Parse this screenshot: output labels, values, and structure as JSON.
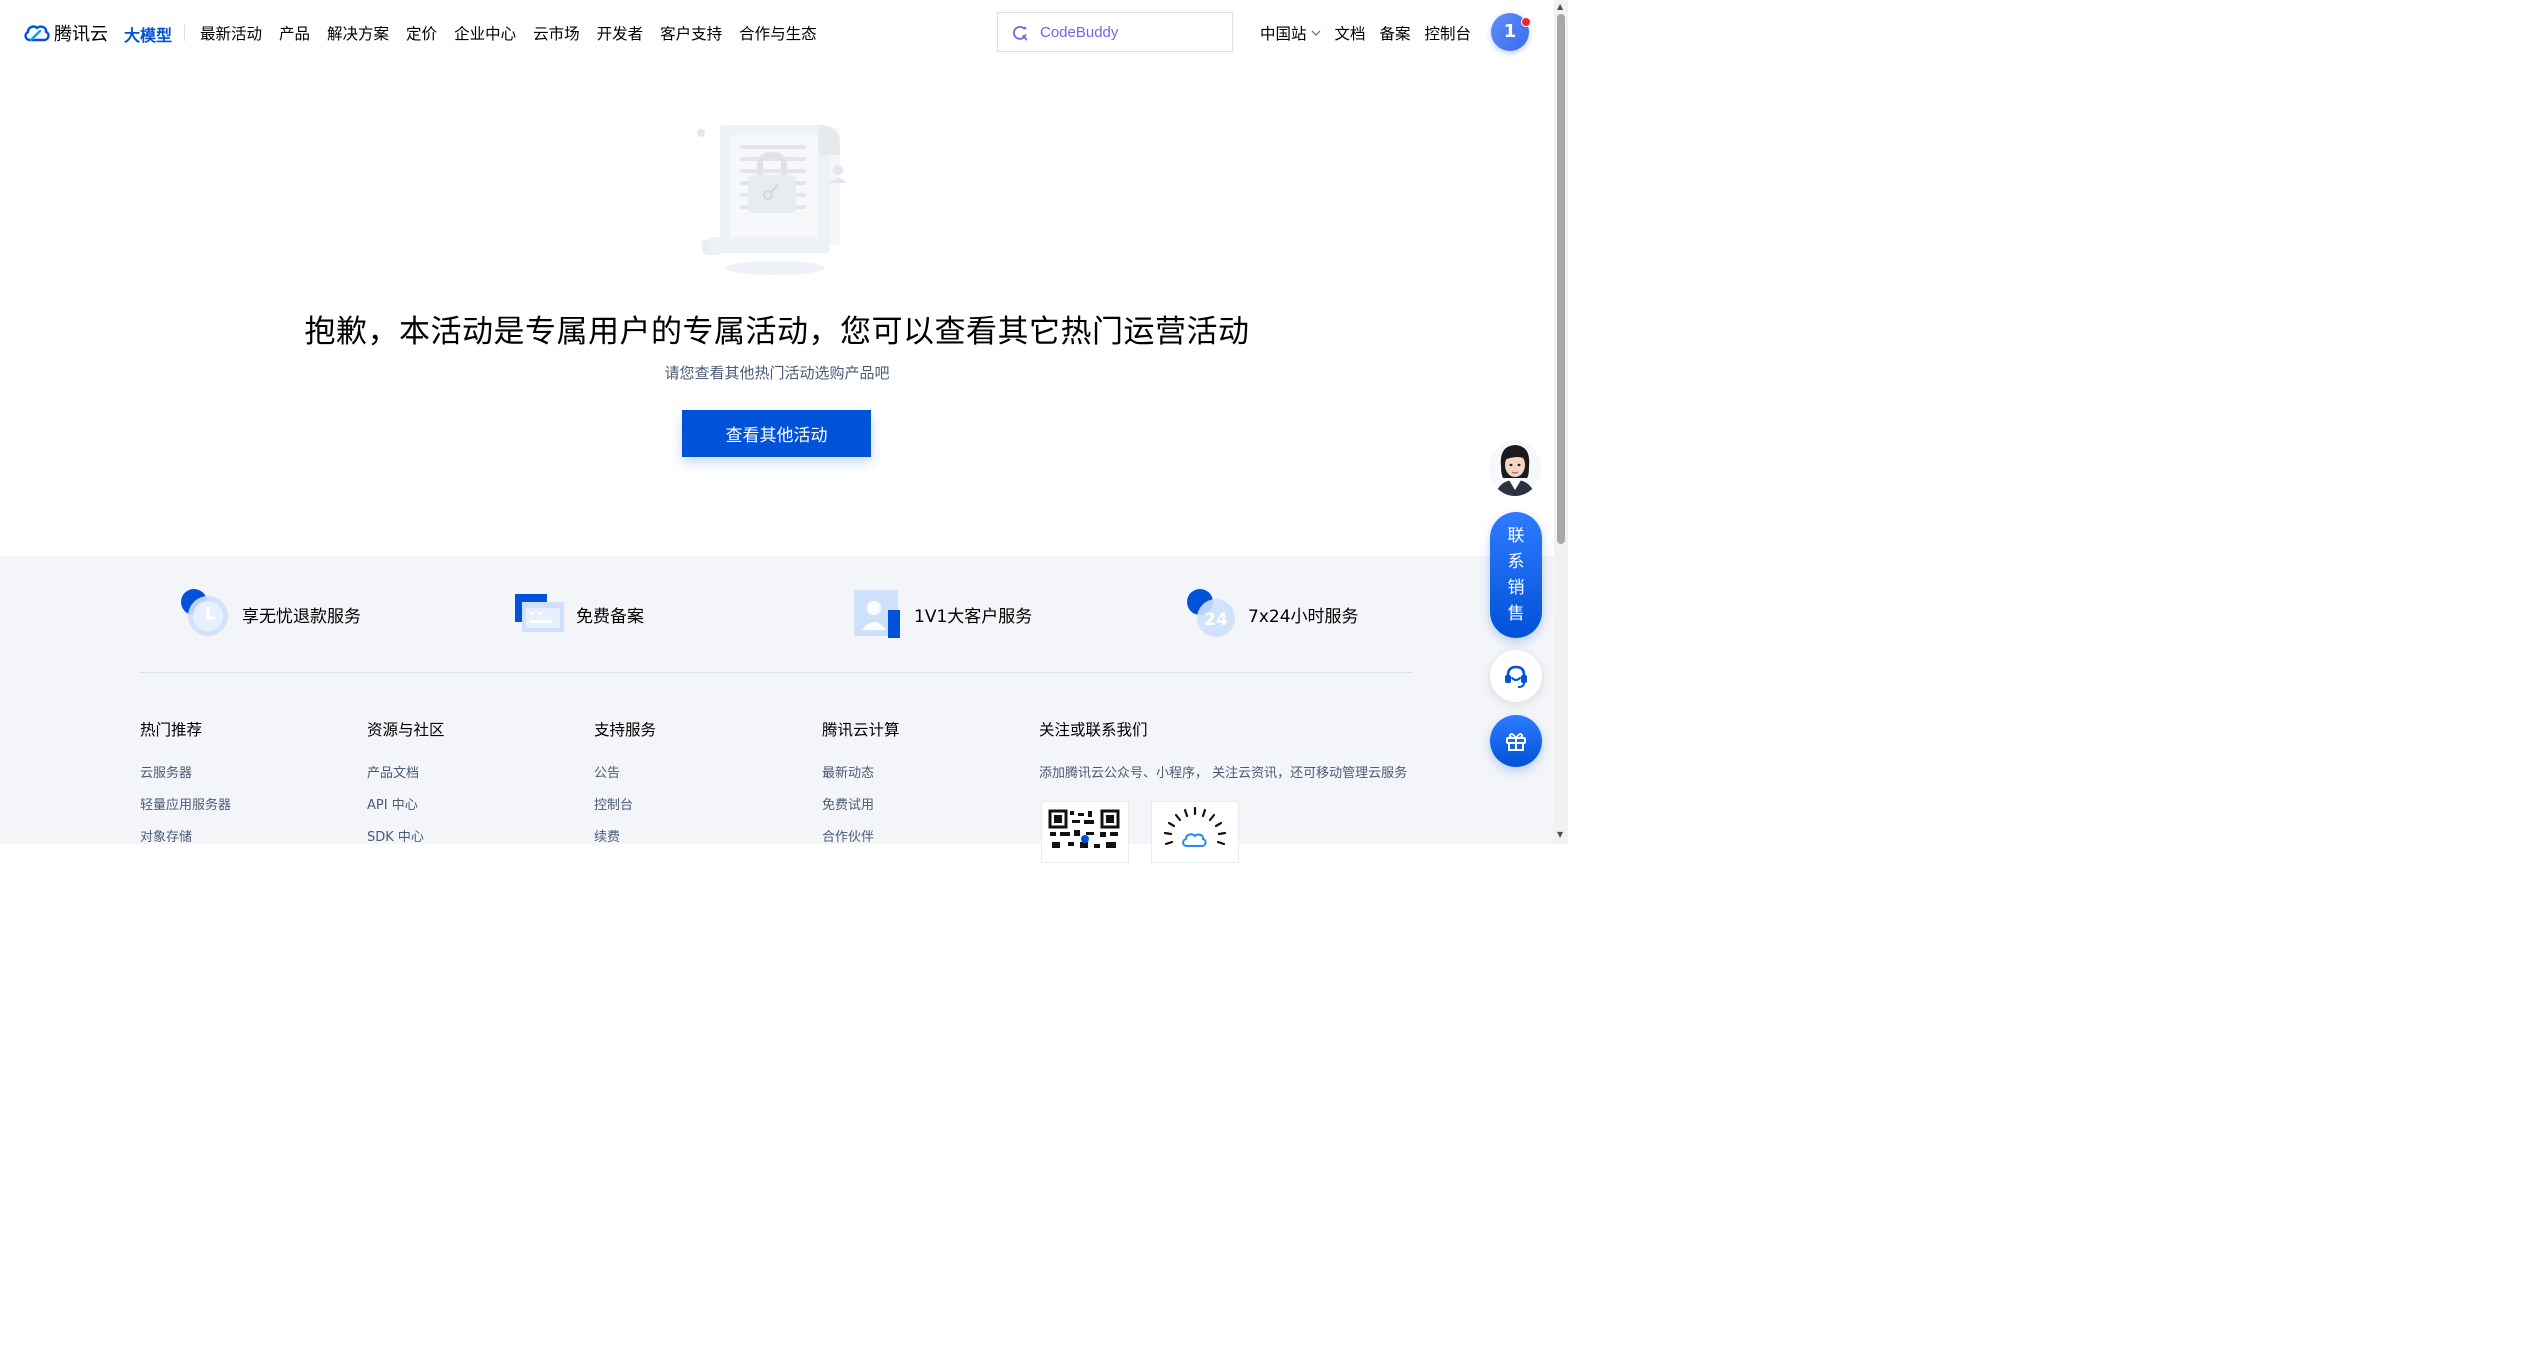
{
  "nav": {
    "logo_text": "腾讯云",
    "ai_label": "大模型",
    "items": [
      "最新活动",
      "产品",
      "解决方案",
      "定价",
      "企业中心",
      "云市场",
      "开发者",
      "客户支持",
      "合作与生态"
    ],
    "search_placeholder": "CodeBuddy",
    "region": "中国站",
    "links": [
      "文档",
      "备案",
      "控制台"
    ],
    "avatar_initial": "1"
  },
  "hero": {
    "title": "抱歉，本活动是专属用户的专属活动，您可以查看其它热门运营活动",
    "subtitle": "请您查看其他热门活动选购产品吧",
    "button_label": "查看其他活动"
  },
  "features": [
    {
      "label": "享无忧退款服务",
      "icon": "refund-clock-icon"
    },
    {
      "label": "免费备案",
      "icon": "filing-card-icon"
    },
    {
      "label": "1V1大客户服务",
      "icon": "person-service-icon"
    },
    {
      "label": "7x24小时服务",
      "icon": "24-hour-icon"
    }
  ],
  "footer": {
    "columns": [
      {
        "title": "热门推荐",
        "links": [
          "云服务器",
          "轻量应用服务器",
          "对象存储"
        ]
      },
      {
        "title": "资源与社区",
        "links": [
          "产品文档",
          "API 中心",
          "SDK 中心"
        ]
      },
      {
        "title": "支持服务",
        "links": [
          "公告",
          "控制台",
          "续费"
        ]
      },
      {
        "title": "腾讯云计算",
        "links": [
          "最新动态",
          "免费试用",
          "合作伙伴"
        ]
      }
    ],
    "contact": {
      "title": "关注或联系我们",
      "desc": "添加腾讯云公众号、小程序， 关注云资讯，还可移动管理云服务"
    }
  },
  "float": {
    "contact_sales": [
      "联",
      "系",
      "销",
      "售"
    ]
  },
  "colors": {
    "brand": "#0052d9",
    "footer_bg": "#f3f5f8",
    "search_text": "#7a62e6"
  }
}
